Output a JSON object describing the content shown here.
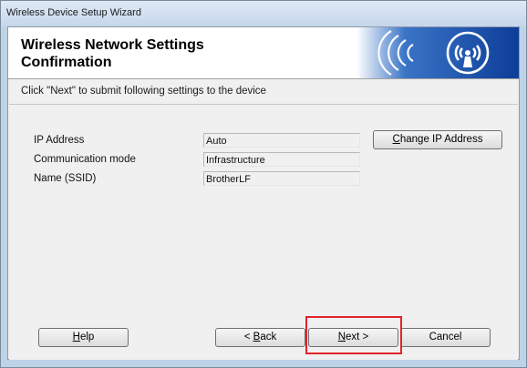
{
  "window": {
    "title": "Wireless Device Setup Wizard"
  },
  "header": {
    "title": "Wireless Network Settings Confirmation"
  },
  "instruction": "Click \"Next\" to submit following settings to the device",
  "settings": [
    {
      "label": "IP Address",
      "value": "Auto"
    },
    {
      "label": "Communication mode",
      "value": "Infrastructure"
    },
    {
      "label": "Name (SSID)",
      "value": "BrotherLF"
    }
  ],
  "buttons": {
    "change_ip": {
      "mnemonic": "C",
      "rest": "hange IP Address"
    },
    "help": {
      "mnemonic": "H",
      "rest": "elp"
    },
    "back": {
      "prefix": "< ",
      "mnemonic": "B",
      "rest": "ack"
    },
    "next": {
      "mnemonic": "N",
      "rest": "ext >"
    },
    "cancel": {
      "label": "Cancel"
    }
  },
  "icons": {
    "banner": "wireless-signal-icon"
  },
  "colors": {
    "highlight": "#e0242b",
    "banner_dark": "#0d3d99",
    "banner_light": "#3a74c6"
  }
}
